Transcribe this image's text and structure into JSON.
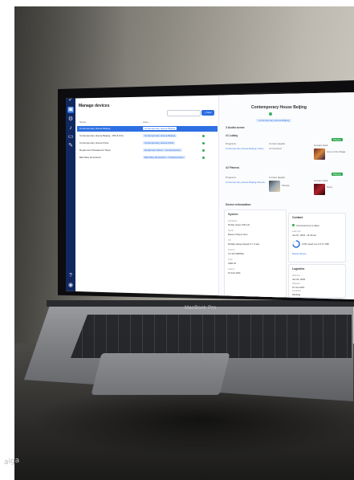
{
  "scene": {
    "laptop_model_label": "MacBook Pro",
    "bottom_left_text": "aiga"
  },
  "app": {
    "left": {
      "title": "Manage devices",
      "search_placeholder": "Search...",
      "new_button": "+ New",
      "columns": [
        "Name",
        "Zone"
      ],
      "rows": [
        {
          "name": "Contemporary House Beijing",
          "zone": "Contemporary House Beijing",
          "selected": true
        },
        {
          "name": "Contemporary House Beijing - DM & Pub",
          "zone": "Contemporary House Beijing",
          "selected": false
        },
        {
          "name": "Contemporary House Paris",
          "zone": "Contemporary House Paris",
          "selected": false
        },
        {
          "name": "Deparment Restaurant Tokyo",
          "zone": "Deparment Store - Contemporary",
          "selected": false
        },
        {
          "name": "Bell Alley Downtown",
          "zone": "Bell Alley Downtown - Contemporary",
          "selected": false
        }
      ]
    },
    "right": {
      "zone_title": "Contemporary House Beijing",
      "zone_badge": "Contemporary House Beijing",
      "audio_zones_label": "2 Audio zones",
      "lobby": {
        "name": "#1 Lobby",
        "program_label": "Programs",
        "program_value": "Contemporary House Beijing Lobby",
        "current_playlist_label": "Current playlist",
        "current_playlist_value": "Unmounted",
        "current_track_label": "Current track",
        "current_track_value": "Live on the Stage",
        "playing_label": "Playing"
      },
      "fitness": {
        "name": "#2 Fitness",
        "program_label": "Programs",
        "program_value": "Contemporary House Beijing Fitness",
        "current_playlist_label": "Current playlist",
        "current_playlist_value": "Fitness",
        "current_track_label": "Current track",
        "current_track_value": "Sorry",
        "playing_label": "Playing"
      },
      "device_info_label": "Device information",
      "system": {
        "title": "System",
        "items": [
          {
            "k": "Hardware",
            "v": "Mobile player (Mini-A)"
          },
          {
            "k": "Serial",
            "v": "Beacon Player Zero"
          },
          {
            "k": "OS",
            "v": "Mobility (Easy-based) 2.7.4-dev"
          },
          {
            "k": "Version",
            "v": "3.6.18 (368000)"
          },
          {
            "k": "Type",
            "v": "ARM 64"
          },
          {
            "k": "Uptime",
            "v": "19 Feb 2021"
          }
        ]
      },
      "contact": {
        "title": "Contact",
        "connected_label": "Connected (up to date)",
        "last_sync_label": "Last sync",
        "last_sync_value": "Jan 07, 2021 - 11:00 am",
        "storage_label": "3.6/5 (used out of 4.17 GB)",
        "storage_percent": 72,
        "delete_button": "Delete Device"
      },
      "logistics": {
        "title": "Logistics",
        "items": [
          {
            "k": "Planned",
            "v": "Jan 03, 2020"
          },
          {
            "k": "Shipped",
            "v": "07 Jan 2021"
          },
          {
            "k": "Condition",
            "v": "Working"
          }
        ]
      }
    }
  }
}
